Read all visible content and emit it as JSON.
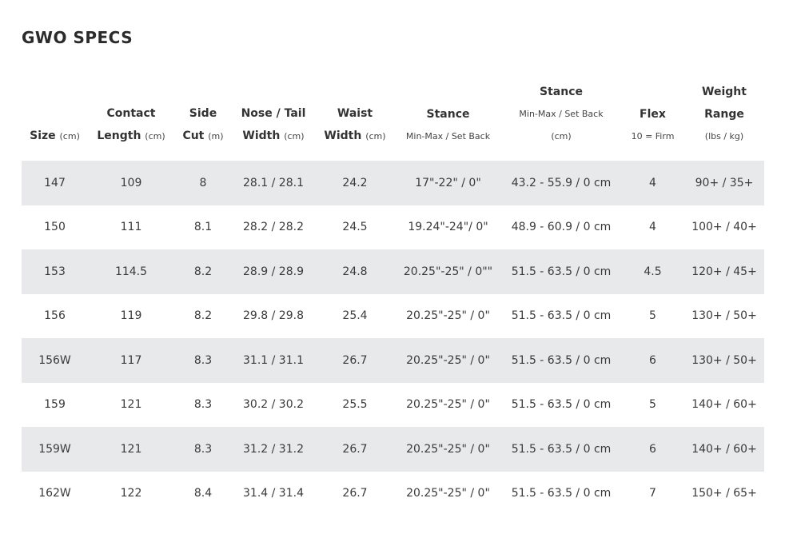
{
  "page_title": "GWO SPECS",
  "columns": [
    {
      "lines": [
        {
          "text": "Size",
          "unit": "(cm)"
        }
      ]
    },
    {
      "lines": [
        {
          "text": "Contact",
          "unit": ""
        },
        {
          "text": "Length",
          "unit": "(cm)"
        }
      ]
    },
    {
      "lines": [
        {
          "text": "Side",
          "unit": ""
        },
        {
          "text": "Cut",
          "unit": "(m)"
        }
      ]
    },
    {
      "lines": [
        {
          "text": "Nose / Tail",
          "unit": ""
        },
        {
          "text": "Width",
          "unit": "(cm)"
        }
      ]
    },
    {
      "lines": [
        {
          "text": "Waist",
          "unit": ""
        },
        {
          "text": "Width",
          "unit": "(cm)"
        }
      ]
    },
    {
      "lines": [
        {
          "text": "Stance",
          "unit": ""
        }
      ],
      "sub": [
        "Min-Max / Set Back"
      ]
    },
    {
      "lines": [
        {
          "text": "Stance",
          "unit": ""
        }
      ],
      "sub": [
        "Min-Max / Set Back",
        "(cm)"
      ]
    },
    {
      "lines": [
        {
          "text": "Flex",
          "unit": ""
        }
      ],
      "sub": [
        "10 = Firm"
      ]
    },
    {
      "lines": [
        {
          "text": "Weight",
          "unit": ""
        },
        {
          "text": "Range",
          "unit": ""
        }
      ],
      "sub": [
        "(lbs / kg)"
      ]
    }
  ],
  "rows": [
    [
      "147",
      "109",
      "8",
      "28.1 / 28.1",
      "24.2",
      "17\"-22\" / 0\"",
      "43.2 - 55.9 / 0 cm",
      "4",
      "90+ / 35+"
    ],
    [
      "150",
      "111",
      "8.1",
      "28.2 / 28.2",
      "24.5",
      "19.24\"-24\"/ 0\"",
      "48.9 - 60.9 / 0 cm",
      "4",
      "100+ / 40+"
    ],
    [
      "153",
      "114.5",
      "8.2",
      "28.9 / 28.9",
      "24.8",
      "20.25\"-25\" / 0\"\"",
      "51.5 - 63.5 / 0 cm",
      "4.5",
      "120+ / 45+"
    ],
    [
      "156",
      "119",
      "8.2",
      "29.8 / 29.8",
      "25.4",
      "20.25\"-25\" / 0\"",
      "51.5 - 63.5 / 0 cm",
      "5",
      "130+ / 50+"
    ],
    [
      "156W",
      "117",
      "8.3",
      "31.1 / 31.1",
      "26.7",
      "20.25\"-25\" / 0\"",
      "51.5 - 63.5 / 0 cm",
      "6",
      "130+ / 50+"
    ],
    [
      "159",
      "121",
      "8.3",
      "30.2 / 30.2",
      "25.5",
      "20.25\"-25\" / 0\"",
      "51.5 - 63.5 / 0 cm",
      "5",
      "140+ / 60+"
    ],
    [
      "159W",
      "121",
      "8.3",
      "31.2 / 31.2",
      "26.7",
      "20.25\"-25\" / 0\"",
      "51.5 - 63.5 / 0 cm",
      "6",
      "140+ / 60+"
    ],
    [
      "162W",
      "122",
      "8.4",
      "31.4 / 31.4",
      "26.7",
      "20.25\"-25\" / 0\"",
      "51.5 - 63.5 / 0 cm",
      "7",
      "150+ / 65+"
    ]
  ],
  "colors": {
    "shaded_row": "#e8e9eb",
    "text": "#3a3a3a"
  }
}
